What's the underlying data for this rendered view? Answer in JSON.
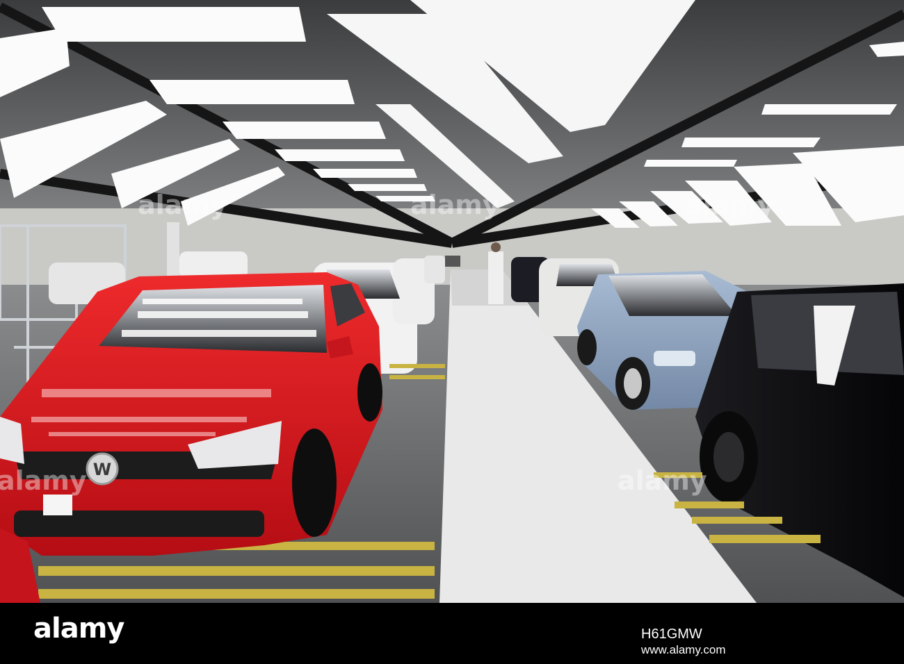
{
  "footer": {
    "logo": "alamy",
    "image_id": "H61GMW",
    "url": "www.alamy.com"
  },
  "watermark": "alamy",
  "colors": {
    "red_car": "#d8121a",
    "light_blue_car": "#8ea3bf",
    "white_car": "#f1f1f1",
    "black_car": "#0c0c0e",
    "walkway": "#e9e9e9",
    "floor": "#5c5e60"
  }
}
